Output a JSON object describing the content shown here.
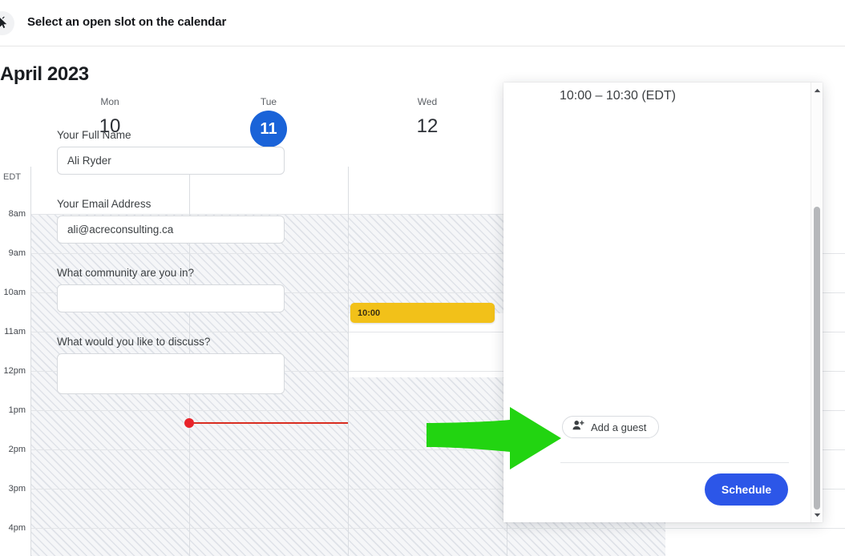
{
  "instruction": {
    "text": "Select an open slot on the calendar",
    "icon": "cursor-click-icon"
  },
  "calendar": {
    "month_title": "April 2023",
    "timezone_label": "EDT",
    "days": [
      {
        "name": "Mon",
        "number": "10",
        "today": false
      },
      {
        "name": "Tue",
        "number": "11",
        "today": true
      },
      {
        "name": "Wed",
        "number": "12",
        "today": false
      }
    ],
    "hour_labels": [
      "8am",
      "9am",
      "10am",
      "11am",
      "12pm",
      "1pm",
      "2pm",
      "3pm",
      "4pm"
    ],
    "event": {
      "time_label": "10:00",
      "color": "#f2c119"
    },
    "current_time_indicator_color": "#e8232a",
    "today_circle_color": "#1a63d8"
  },
  "booking_panel": {
    "clipped_header": "",
    "slot_time": "10:00 – 10:30 (EDT)",
    "fields": [
      {
        "label": "Your Full Name",
        "value": "Ali Ryder",
        "placeholder": "",
        "type": "text"
      },
      {
        "label": "Your Email Address",
        "value": "ali@acreconsulting.ca",
        "placeholder": "",
        "type": "text"
      },
      {
        "label": "What community are you in?",
        "value": "",
        "placeholder": "",
        "type": "text"
      },
      {
        "label": "What would you like to discuss?",
        "value": "",
        "placeholder": "",
        "type": "textarea"
      }
    ],
    "add_guest_label": "Add a guest",
    "add_guest_icon": "person-add-icon",
    "schedule_label": "Schedule",
    "schedule_color": "#2c56e8"
  },
  "annotation": {
    "arrow_color": "#22d411",
    "direction": "right"
  }
}
